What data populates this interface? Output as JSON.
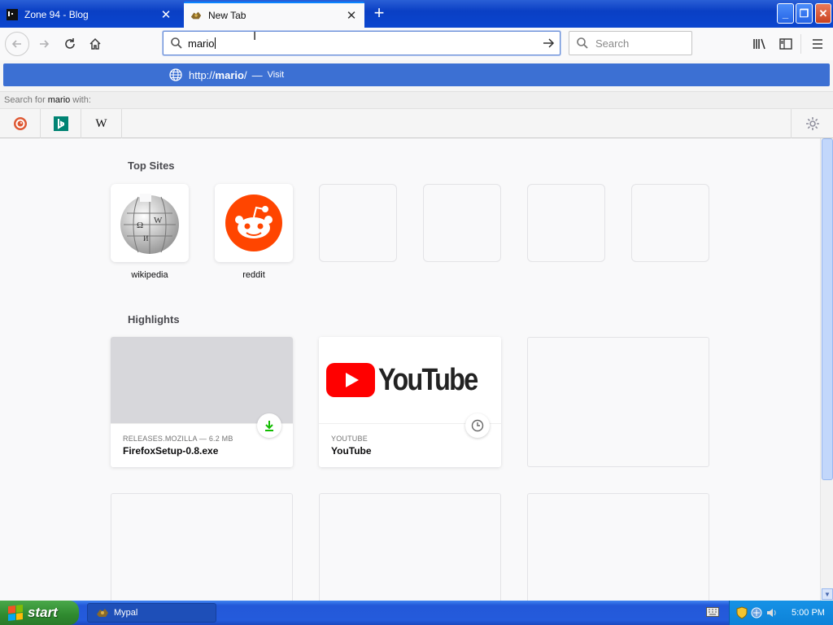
{
  "tabs": [
    {
      "title": "Zone 94 - Blog",
      "active": false
    },
    {
      "title": "New Tab",
      "active": true
    }
  ],
  "url_input": {
    "value": "mario"
  },
  "search_box": {
    "placeholder": "Search"
  },
  "suggestion": {
    "prefix": "http://",
    "term": "mario",
    "suffix": "/",
    "dash": "—",
    "action": "Visit"
  },
  "search_with": {
    "before": "Search for",
    "term": "mario",
    "after": "with:"
  },
  "engines": [
    "DuckDuckGo",
    "Bing",
    "Wikipedia"
  ],
  "top_sites": {
    "heading": "Top Sites",
    "items": [
      {
        "label": "wikipedia",
        "icon": "wikipedia-globe-icon"
      },
      {
        "label": "reddit",
        "icon": "reddit-icon"
      }
    ]
  },
  "highlights": {
    "heading": "Highlights",
    "cards": [
      {
        "host": "RELEASES.MOZILLA — 6.2 MB",
        "title": "FirefoxSetup-0.8.exe",
        "badge": "download-icon"
      },
      {
        "host": "YOUTUBE",
        "title": "YouTube",
        "logo_text": "YouTube",
        "badge": "clock-icon"
      }
    ]
  },
  "taskbar": {
    "start_label": "start",
    "task_label": "Mypal",
    "clock": "5:00 PM"
  },
  "colors": {
    "selection_blue": "#3c70d3",
    "xp_taskbar": "#245bdc",
    "start_green": "#2f8a2f",
    "reddit_orange": "#ff4500",
    "youtube_red": "#ff0000"
  }
}
